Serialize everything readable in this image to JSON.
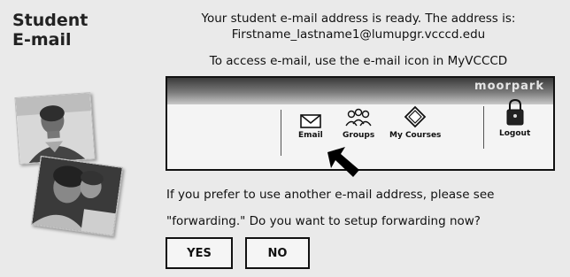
{
  "sidebar": {
    "title_line1": "Student",
    "title_line2": "E-mail"
  },
  "main": {
    "intro": "Your student e-mail address is ready. The address is:",
    "address": "Firstname_lastname1@lumupgr.vcccd.edu",
    "instruction": "To access e-mail, use the e-mail icon in MyVCCCD",
    "forwarding_q1": "If you prefer to use another e-mail address, please see",
    "forwarding_q2": "\"forwarding.\" Do you want to setup forwarding now?"
  },
  "toolbar": {
    "banner_text": "moorpark",
    "items": [
      {
        "label": "Email",
        "icon": "envelope-icon"
      },
      {
        "label": "Groups",
        "icon": "people-icon"
      },
      {
        "label": "My Courses",
        "icon": "courses-icon"
      },
      {
        "label": "Logout",
        "icon": "padlock-icon"
      }
    ]
  },
  "buttons": {
    "yes": "YES",
    "no": "NO"
  },
  "photos": [
    {
      "depicts": "student-man-photo"
    },
    {
      "depicts": "students-at-computer-photo"
    }
  ]
}
